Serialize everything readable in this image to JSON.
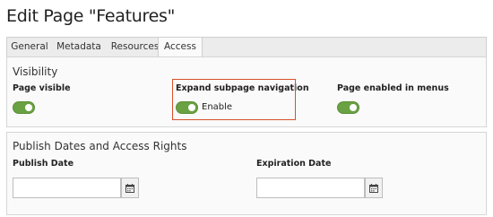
{
  "page": {
    "title": "Edit Page \"Features\""
  },
  "tabs": [
    {
      "label": "General",
      "active": false
    },
    {
      "label": "Metadata",
      "active": false
    },
    {
      "label": "Resources",
      "active": false
    },
    {
      "label": "Access",
      "active": true
    }
  ],
  "visibility": {
    "title": "Visibility",
    "page_visible": {
      "label": "Page visible",
      "enabled": true
    },
    "expand_subpage": {
      "label": "Expand subpage navigation",
      "toggle_text": "Enable",
      "enabled": true
    },
    "enabled_in_menus": {
      "label": "Page enabled in menus",
      "enabled": true
    }
  },
  "publish": {
    "title": "Publish Dates and Access Rights",
    "publish_date": {
      "label": "Publish Date",
      "value": ""
    },
    "expiration_date": {
      "label": "Expiration Date",
      "value": ""
    }
  },
  "colors": {
    "toggle_on": "#6aa143",
    "highlight": "#d9512c"
  },
  "icons": {
    "date_picker": "calendar-icon"
  }
}
